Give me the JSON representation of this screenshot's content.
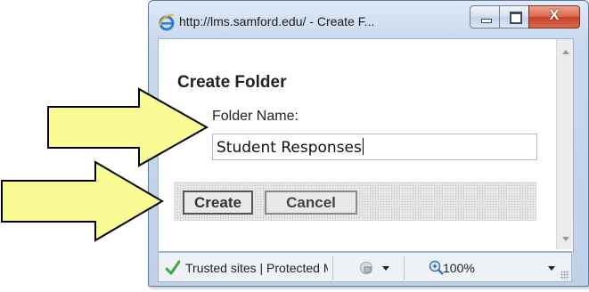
{
  "window": {
    "title": "http://lms.samford.edu/ - Create F...",
    "controls": {
      "close_label": "X"
    }
  },
  "dialog": {
    "heading": "Create Folder",
    "folder_name_label": "Folder Name:",
    "folder_name_value": "Student Responses",
    "create_label": "Create",
    "cancel_label": "Cancel"
  },
  "statusbar": {
    "zone_text": "Trusted sites | Protected Mode: Off",
    "zoom": "100%"
  },
  "colors": {
    "arrow_fill": "#fbfb96",
    "arrow_stroke": "#000000",
    "close_button": "#d9654a"
  }
}
